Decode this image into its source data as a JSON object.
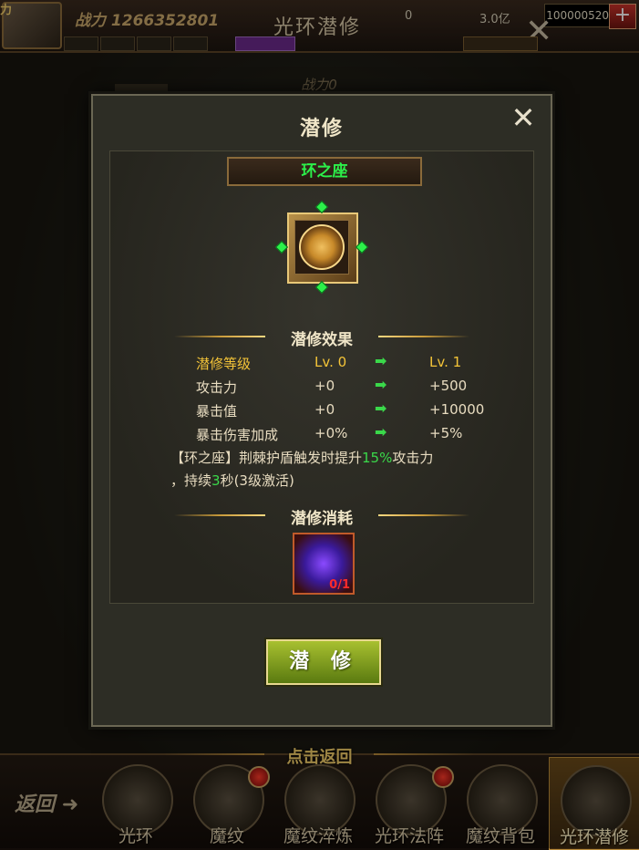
{
  "topbar": {
    "avatar_tag": "力",
    "power_label": "战力 1266352801",
    "title": "光环潜修",
    "resource1": "0",
    "resource2": "3.0亿",
    "gold_value": "100000520",
    "plus_label": "+"
  },
  "background": {
    "power": "战力0"
  },
  "modal": {
    "title": "潜修",
    "item_name": "环之座",
    "effect_title": "潜修效果",
    "stats": [
      {
        "name": "潜修等级",
        "from": "Lv. 0",
        "to": "Lv. 1"
      },
      {
        "name": "攻击力",
        "from": "+0",
        "to": "+500"
      },
      {
        "name": "暴击值",
        "from": "+0",
        "to": "+10000"
      },
      {
        "name": "暴击伤害加成",
        "from": "+0%",
        "to": "+5%"
      }
    ],
    "arrow": "➡",
    "desc_part1": "【环之座】荆棘护盾触发时提升",
    "desc_highlight1": "15%",
    "desc_part2": "攻击力",
    "desc_part3": "，持续",
    "desc_highlight2": "3",
    "desc_part4": "秒(3级激活)",
    "cost_title": "潜修消耗",
    "cost_count": "0/1",
    "action_label": "潜 修",
    "close_icon": "close-icon",
    "name_color": "#2cf04a"
  },
  "bottom": {
    "return_label": "点击返回",
    "back_label": "返回",
    "nav": [
      {
        "label": "光环",
        "active": false,
        "dot": false
      },
      {
        "label": "魔纹",
        "active": false,
        "dot": true
      },
      {
        "label": "魔纹淬炼",
        "active": false,
        "dot": false
      },
      {
        "label": "光环法阵",
        "active": false,
        "dot": true
      },
      {
        "label": "魔纹背包",
        "active": false,
        "dot": false
      },
      {
        "label": "光环潜修",
        "active": true,
        "dot": false
      }
    ]
  }
}
